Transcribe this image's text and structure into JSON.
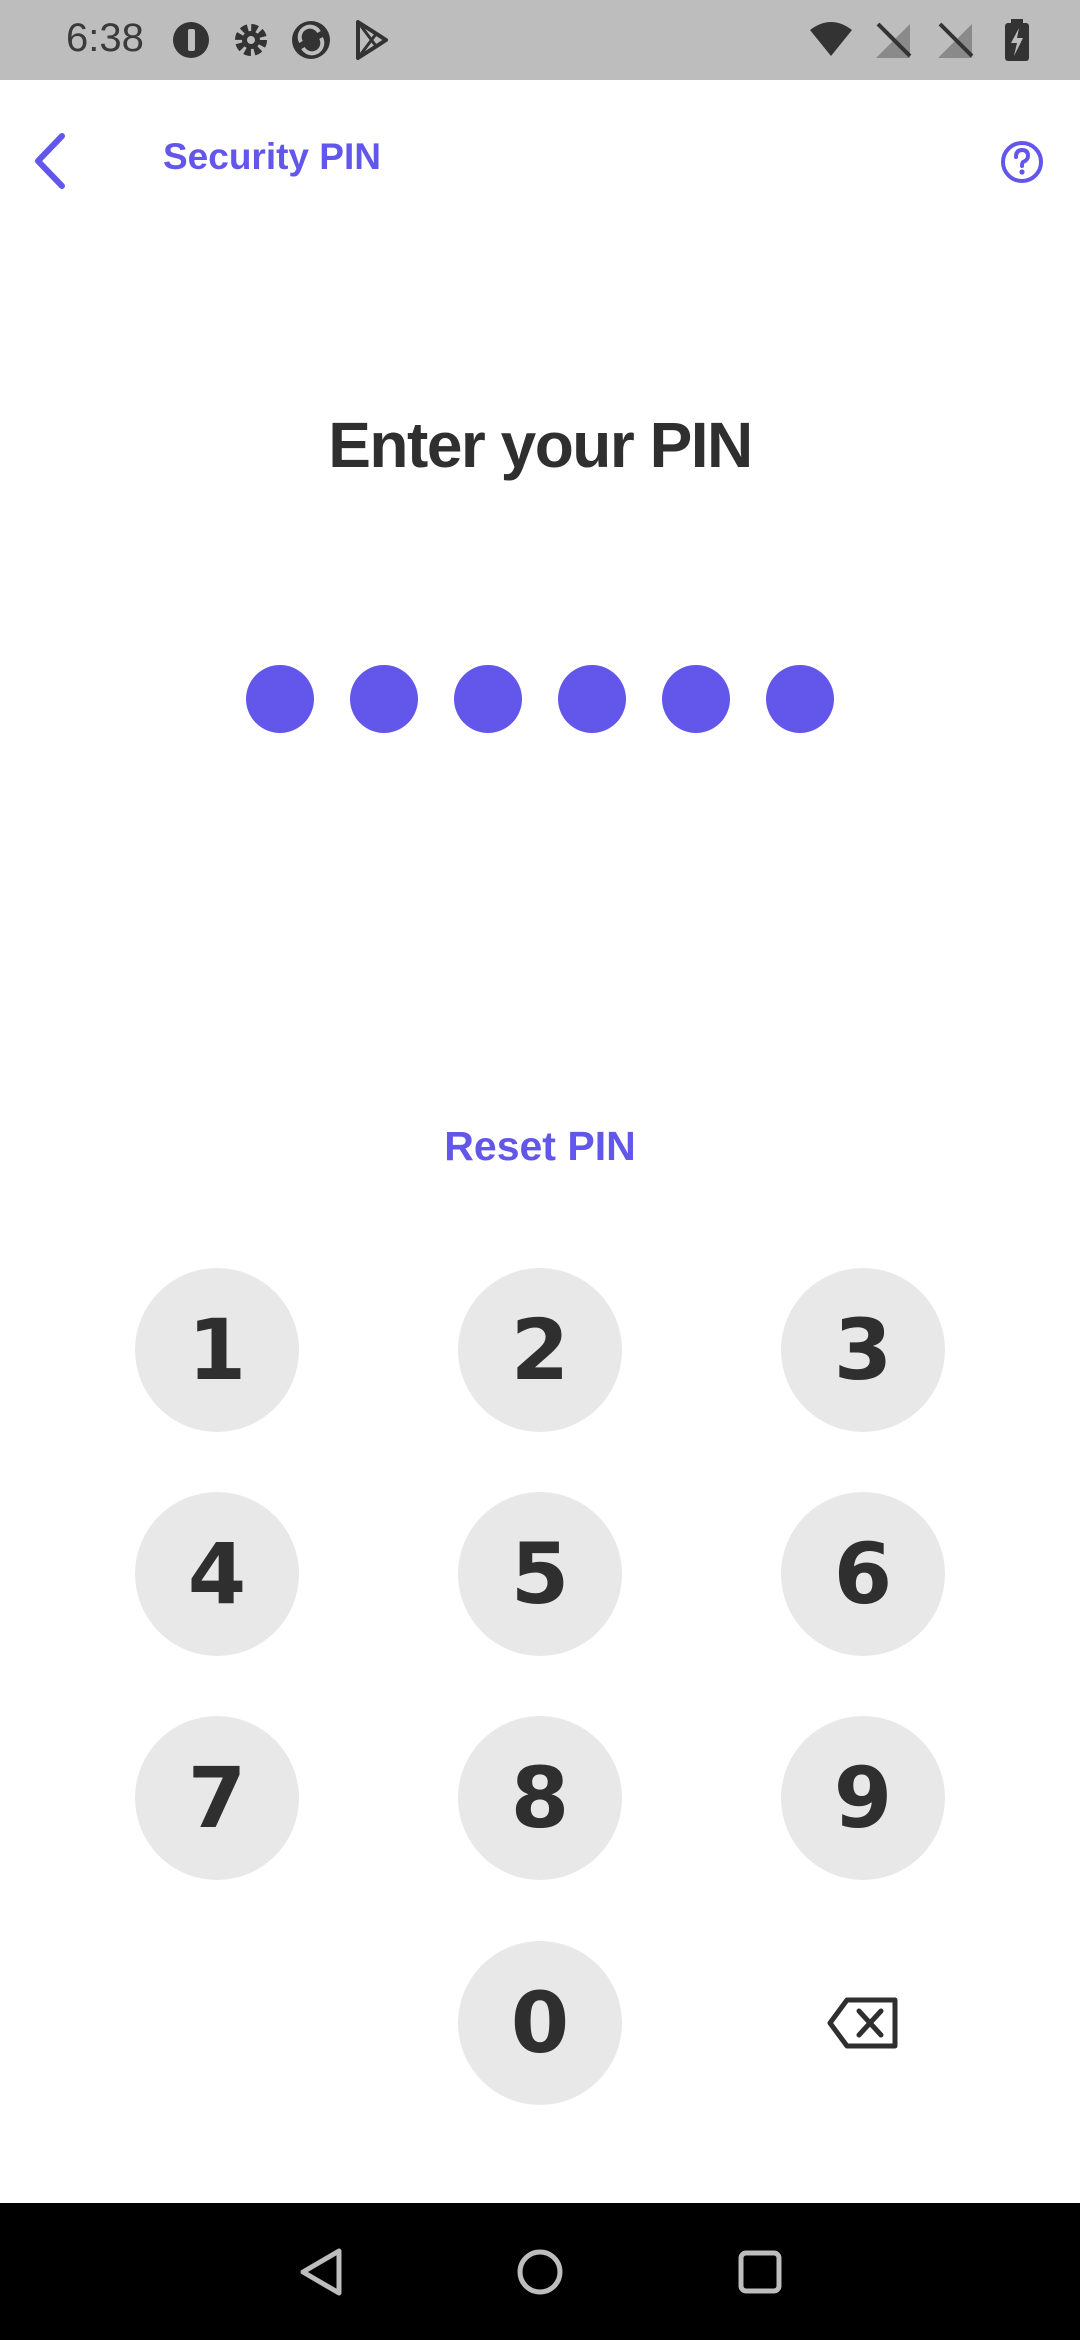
{
  "status_bar": {
    "time": "6:38",
    "left_icons": [
      "app-notification-icon",
      "settings-gear-icon",
      "sync-app-icon",
      "play-store-icon"
    ],
    "right_icons": [
      "wifi-icon",
      "no-sim-icon",
      "no-sim-icon",
      "battery-charging-icon"
    ]
  },
  "app_bar": {
    "title": "Security PIN",
    "back_icon": "chevron-left-icon",
    "help_icon": "help-circle-icon"
  },
  "main": {
    "heading": "Enter your PIN",
    "pin_length": 6,
    "entered_digits": 6,
    "reset_label": "Reset PIN"
  },
  "keypad": {
    "keys": [
      "1",
      "2",
      "3",
      "4",
      "5",
      "6",
      "7",
      "8",
      "9",
      "0"
    ],
    "backspace_icon": "backspace-icon"
  },
  "colors": {
    "accent": "#6257ea",
    "text_dark": "#2f2f2f",
    "key_bg": "#e8e8e8",
    "status_bar_bg": "#bdbdbd"
  },
  "nav_bar": {
    "icons": [
      "back-triangle-icon",
      "home-circle-icon",
      "recents-square-icon"
    ]
  }
}
